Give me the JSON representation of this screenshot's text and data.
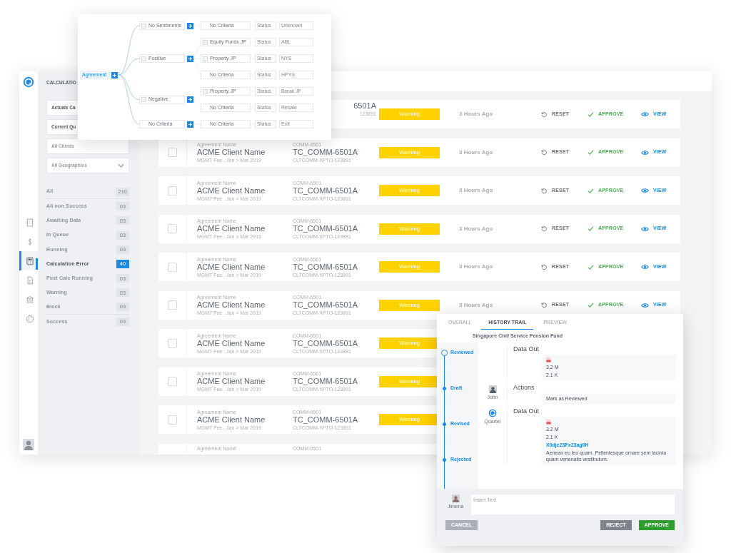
{
  "nav": {
    "items": [
      {
        "kind": "building",
        "selected": false
      },
      {
        "kind": "dollar",
        "selected": false
      },
      {
        "kind": "calculator",
        "selected": true
      },
      {
        "kind": "document",
        "selected": false
      },
      {
        "kind": "bank",
        "selected": false
      },
      {
        "kind": "globe",
        "selected": false
      }
    ]
  },
  "filter_panel": {
    "title": "CALCULATIO",
    "dropdowns": [
      {
        "text": "Actuals Ca"
      },
      {
        "text": "Current Qu"
      },
      {
        "text": "All Clients"
      },
      {
        "text": "All Geographies",
        "caret": true
      }
    ],
    "statuses": [
      {
        "label": "All",
        "count": "210",
        "selected": false
      },
      {
        "label": "All non Success",
        "count": "03",
        "selected": false
      },
      {
        "label": "Awaiting Data",
        "count": "03",
        "selected": false
      },
      {
        "label": "In Queue",
        "count": "03",
        "selected": false
      },
      {
        "label": "Running",
        "count": "03",
        "selected": false
      },
      {
        "label": "Calculation Error",
        "count": "40",
        "selected": true
      },
      {
        "label": "Post Calc Running",
        "count": "03",
        "selected": false
      },
      {
        "label": "Warning",
        "count": "03",
        "selected": false
      },
      {
        "label": "Block",
        "count": "03",
        "selected": false
      },
      {
        "label": "Success",
        "count": "03",
        "selected": false
      }
    ]
  },
  "rows": [
    {
      "code": "6501A",
      "ref": "123891",
      "status": "Warning",
      "time": "3 Hours Ago",
      "actions": [
        {
          "kind": "reset",
          "label": "RESET"
        },
        {
          "kind": "approve",
          "label": "APPROVE"
        },
        {
          "kind": "view",
          "label": "VIEW"
        }
      ]
    },
    {
      "checked": false,
      "label": "Agreement Name",
      "name": "ACME Client Name",
      "detail": "MGMT Fee . Jan > Mar 2019",
      "code_label": "COMM-6501",
      "code": "TC_COMM-6501A",
      "ref": "CLTCOMM-XPTO-123891",
      "status": "Warning",
      "time": "3 Hours Ago",
      "actions": [
        {
          "kind": "reset",
          "label": "RESET"
        },
        {
          "kind": "approve",
          "label": "APPROVE"
        },
        {
          "kind": "view",
          "label": "VIEW"
        }
      ]
    },
    {
      "checked": false,
      "label": "Agreement Name",
      "name": "ACME Client Name",
      "detail": "MGMT Fee . Jan > Mar 2019",
      "code_label": "COMM-6501",
      "code": "TC_COMM-6501A",
      "ref": "CLTCOMM-XPTO-123891",
      "status": "Warning",
      "time": "3 Hours Ago",
      "actions": [
        {
          "kind": "reset",
          "label": "RESET"
        },
        {
          "kind": "approve",
          "label": "APPROVE"
        },
        {
          "kind": "view",
          "label": "VIEW"
        }
      ]
    },
    {
      "checked": false,
      "label": "Agreement Name",
      "name": "ACME Client Name",
      "detail": "MGMT Fee . Jan > Mar 2019",
      "code_label": "COMM-6501",
      "code": "TC_COMM-6501A",
      "ref": "CLTCOMM-XPTO-123891",
      "status": "Warning",
      "time": "3 Hours Ago",
      "actions": [
        {
          "kind": "reset",
          "label": "RESET"
        },
        {
          "kind": "approve",
          "label": "APPROVE"
        },
        {
          "kind": "view",
          "label": "VIEW"
        }
      ]
    },
    {
      "checked": false,
      "label": "Agreement Name",
      "name": "ACME Client Name",
      "detail": "MGMT Fee . Jan > Mar 2019",
      "code_label": "COMM-6501",
      "code": "TC_COMM-6501A",
      "ref": "CLTCOMM-XPTO-123891",
      "status": "Warning",
      "time": "3 Hours Ago",
      "actions": [
        {
          "kind": "reset",
          "label": "RESET"
        },
        {
          "kind": "approve",
          "label": "APPROVE"
        },
        {
          "kind": "view",
          "label": "VIEW"
        }
      ]
    },
    {
      "checked": false,
      "label": "Agreement Name",
      "name": "ACME Client Name",
      "detail": "MGMT Fee . Jan > Mar 2019",
      "code_label": "COMM-6501",
      "code": "TC_COMM-6501A",
      "ref": "CLTCOMM-XPTO-123891",
      "status": "Warning",
      "time": "3 Hours Ago",
      "actions": [
        {
          "kind": "reset",
          "label": "RESET"
        },
        {
          "kind": "approve",
          "label": "APPROVE"
        },
        {
          "kind": "view",
          "label": "VIEW"
        }
      ]
    },
    {
      "checked": false,
      "label": "Agreement Name",
      "name": "ACME Client Name",
      "detail": "MGMT Fee . Jan > Mar 2019",
      "code_label": "COMM-6501",
      "code": "TC_COMM-6501A",
      "ref": "CLTCOMM-XPTO-123891",
      "status": "Warning"
    },
    {
      "checked": false,
      "label": "Agreement Name",
      "name": "ACME Client Name",
      "detail": "MGMT Fee . Jan > Mar 2019",
      "code_label": "COMM-6501",
      "code": "TC_COMM-6501A",
      "ref": "CLTCOMM-XPTO-123891",
      "status": "Warning"
    },
    {
      "checked": false,
      "label": "Agreement Name",
      "name": "ACME Client Name",
      "detail": "MGMT Fee . Jan > Mar 2019",
      "code_label": "COMM-6501",
      "code": "TC_COMM-6501A",
      "ref": "CLTCOMM-XPTO-123891",
      "status": "Warning"
    },
    {
      "label": "Agreement Name",
      "code_label": "COMM-6501"
    }
  ],
  "tree": {
    "root": "Agreement",
    "branches": [
      {
        "label": "No Sentiments",
        "icon": true,
        "children": [
          {
            "label": "No Criteria",
            "icon": false,
            "status": "Status",
            "value": "Unknown"
          }
        ]
      },
      {
        "label": "Positive",
        "icon": true,
        "children": [
          {
            "label": "Equity Funds JP",
            "icon": true,
            "status": "Status",
            "value": "ABL"
          },
          {
            "label": "Property JP",
            "icon": true,
            "status": "Status",
            "value": "NYS"
          },
          {
            "label": "No Criteria",
            "icon": false,
            "status": "Status",
            "value": "HPYS"
          }
        ]
      },
      {
        "label": "Negative",
        "icon": true,
        "children": [
          {
            "label": "Property JP",
            "icon": true,
            "status": "Status",
            "value": "Break JF"
          },
          {
            "label": "No Criteria",
            "icon": false,
            "status": "Status",
            "value": "Resale"
          }
        ]
      },
      {
        "label": "No Criteria",
        "icon": false,
        "children": [
          {
            "label": "No Criteria",
            "icon": false,
            "status": "Status",
            "value": "Exit"
          }
        ]
      }
    ]
  },
  "history": {
    "tabs": [
      {
        "label": "OVERALL",
        "selected": false
      },
      {
        "label": "HISTORY TRAIL",
        "selected": true
      },
      {
        "label": "PREVIEW",
        "selected": false
      }
    ],
    "fund": "Singapore Civil Service Pension Fund",
    "steps": [
      {
        "label": "Reviewed",
        "selected": true
      },
      {
        "label": "Draft",
        "selected": false
      },
      {
        "label": "Revised",
        "selected": false
      },
      {
        "label": "Rejected",
        "selected": false
      }
    ],
    "entries": [
      {
        "title": "Data Out",
        "values": [
          {
            "kind": "file"
          },
          {
            "kind": "text",
            "text": "3.2 M"
          },
          {
            "kind": "text",
            "text": "2.1 K"
          }
        ]
      },
      {
        "title": "Actions",
        "author": {
          "kind": "photo",
          "name": "John"
        },
        "values": [
          {
            "kind": "text",
            "text": "Mark as Reviewed"
          }
        ]
      },
      {
        "title": "Data Out",
        "author": {
          "kind": "logo",
          "name": "Quartel"
        },
        "values": [
          {
            "kind": "file"
          },
          {
            "kind": "text",
            "text": "3.2 M"
          },
          {
            "kind": "text",
            "text": "2.1 K"
          },
          {
            "kind": "link",
            "text": "X0dje23Fx23ag0H"
          },
          {
            "kind": "text",
            "text": "Aenean eu leo quam. Pellentesque ornare sem lacinia quam venenatis vestibulum."
          }
        ]
      }
    ],
    "comment": {
      "author": "Jimena",
      "placeholder": "Insert Text"
    },
    "buttons": [
      {
        "kind": "cancel",
        "label": "CANCEL"
      },
      {
        "kind": "reject",
        "label": "REJECT"
      },
      {
        "kind": "approve",
        "label": "APPROVE"
      }
    ]
  }
}
